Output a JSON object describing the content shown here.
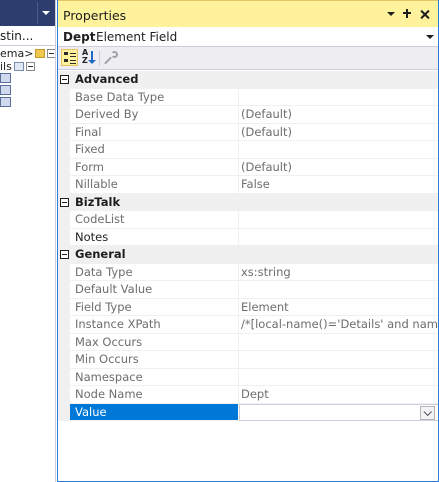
{
  "left_panel": {
    "tab_label": "stin...",
    "tree": [
      {
        "label": "ema>"
      },
      {
        "label": "ils"
      }
    ]
  },
  "properties_window": {
    "title": "Properties",
    "buttons": {
      "options": "▾",
      "pin": "pin",
      "close": "close"
    },
    "object_selector": {
      "name": "Dept",
      "type": "Element Field"
    },
    "toolbar": {
      "categorized": "categorized-view",
      "alphabetical": "alphabetical-view",
      "property_pages": "property-pages"
    },
    "categories": [
      {
        "name": "Advanced",
        "properties": [
          {
            "name": "Base Data Type",
            "value": ""
          },
          {
            "name": "Derived By",
            "value": "(Default)"
          },
          {
            "name": "Final",
            "value": "(Default)"
          },
          {
            "name": "Fixed",
            "value": ""
          },
          {
            "name": "Form",
            "value": "(Default)"
          },
          {
            "name": "Nillable",
            "value": "False"
          }
        ]
      },
      {
        "name": "BizTalk",
        "properties": [
          {
            "name": "CodeList",
            "value": ""
          },
          {
            "name": "Notes",
            "value": ""
          }
        ]
      },
      {
        "name": "General",
        "properties": [
          {
            "name": "Data Type",
            "value": "xs:string"
          },
          {
            "name": "Default Value",
            "value": ""
          },
          {
            "name": "Field Type",
            "value": "Element"
          },
          {
            "name": "Instance XPath",
            "value": "/*[local-name()='Details' and namespa"
          },
          {
            "name": "Max Occurs",
            "value": ""
          },
          {
            "name": "Min Occurs",
            "value": ""
          },
          {
            "name": "Namespace",
            "value": ""
          },
          {
            "name": "Node Name",
            "value": "Dept"
          },
          {
            "name": "Value",
            "value": ""
          }
        ]
      }
    ]
  },
  "colors": {
    "title_bar": "#fff29d",
    "accent_border": "#2b7dd6",
    "selection": "#0078d7",
    "left_header": "#2d3e6e",
    "gutter": "#f0f0f0"
  }
}
